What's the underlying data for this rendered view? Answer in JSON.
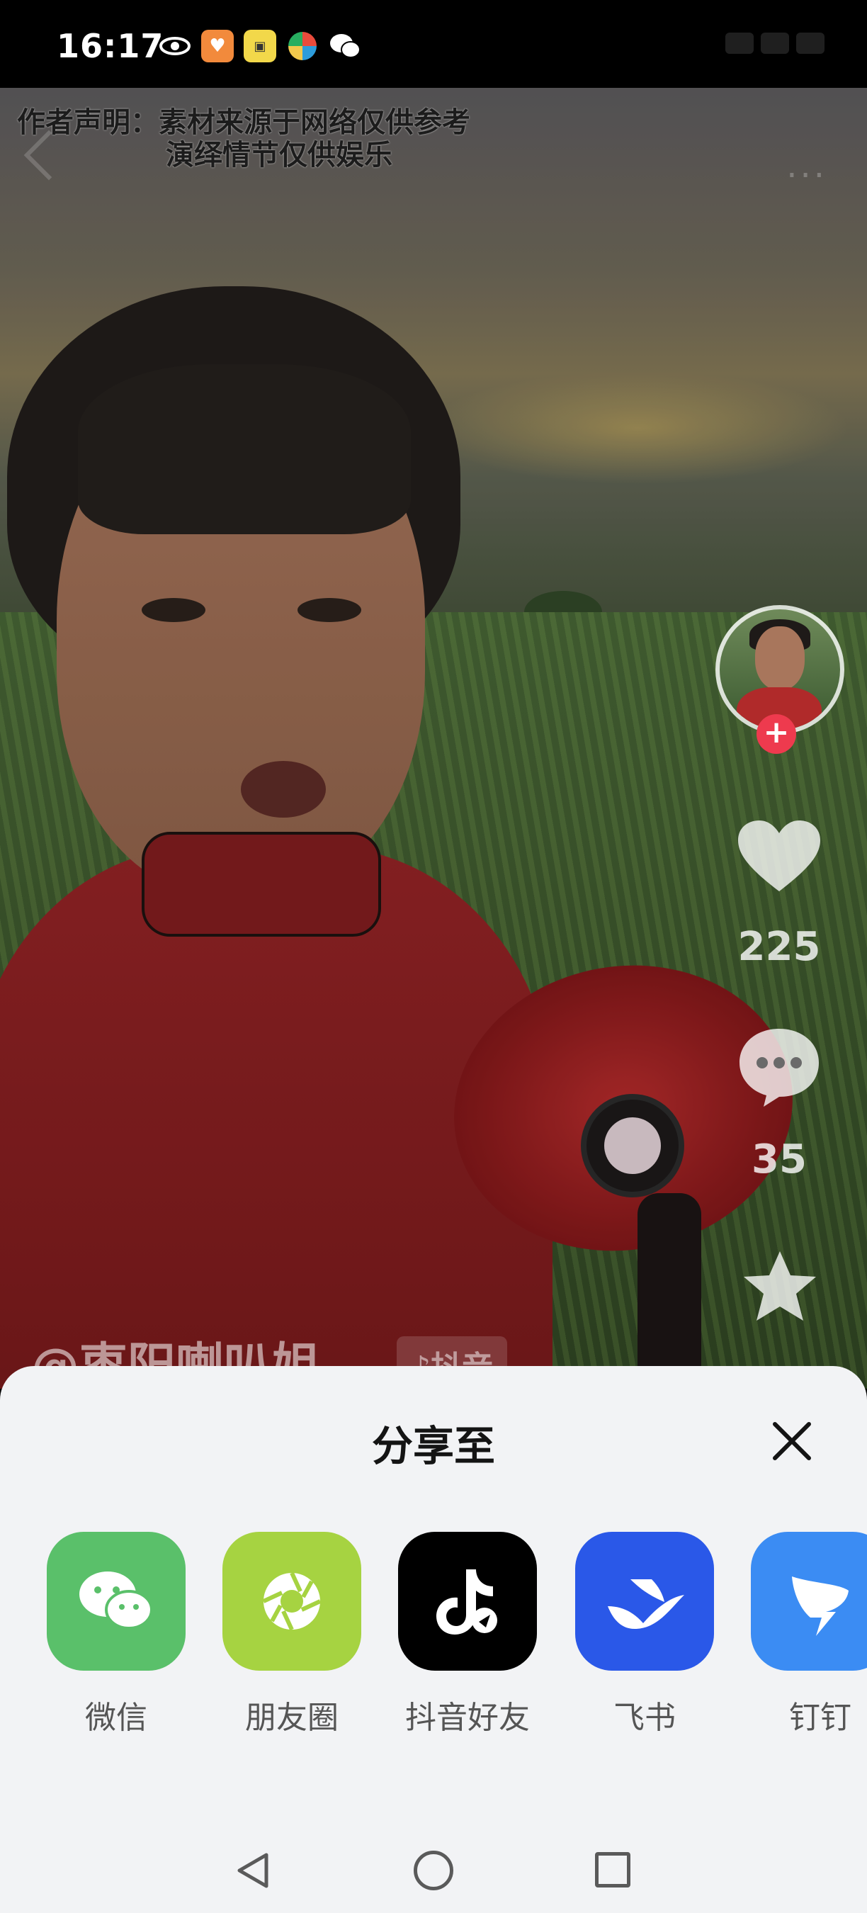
{
  "status_bar": {
    "time": "16:17",
    "icons": [
      "eye-icon",
      "heart-app-icon",
      "app-yellow-icon",
      "pinwheel-icon",
      "wechat-icon"
    ]
  },
  "video": {
    "caption_line1": "作者声明：素材来源于网络仅供参考",
    "caption_line2": "演绎情节仅供娱乐",
    "author": "@枣阳喇叭姐",
    "platform_tag": "♪抖音",
    "likes": "225",
    "comments": "35"
  },
  "share_sheet": {
    "title": "分享至",
    "items": [
      {
        "label": "微信",
        "icon": "wechat-icon",
        "color": "#5ac06a"
      },
      {
        "label": "朋友圈",
        "icon": "moments-icon",
        "color": "#a6d341"
      },
      {
        "label": "抖音好友",
        "icon": "douyin-icon",
        "color": "#000000"
      },
      {
        "label": "飞书",
        "icon": "feishu-icon",
        "color": "#2a58e8"
      },
      {
        "label": "钉钉",
        "icon": "dingtalk-icon",
        "color": "#3b8cf3"
      }
    ]
  },
  "nav": {
    "icons": [
      "back-triangle-icon",
      "home-circle-icon",
      "recent-square-icon"
    ]
  }
}
